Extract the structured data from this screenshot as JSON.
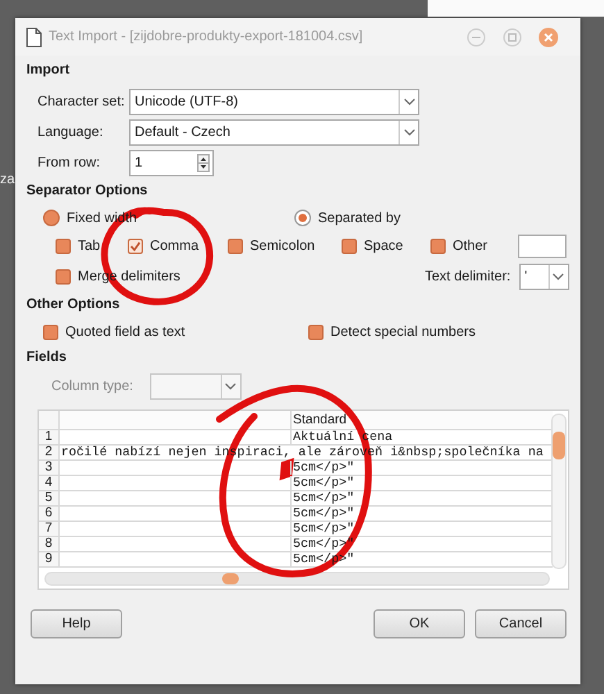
{
  "background": {
    "edge_text": "za"
  },
  "window": {
    "title": "Text Import - [zijdobre-produkty-export-181004.csv]"
  },
  "import": {
    "heading": "Import",
    "fields": [
      {
        "label": "Character set:",
        "value": "Unicode (UTF-8)",
        "kind": "combo"
      },
      {
        "label": "Language:",
        "value": "Default - Czech",
        "kind": "combo"
      },
      {
        "label": "From row:",
        "value": "1",
        "kind": "spin"
      }
    ]
  },
  "separator_options": {
    "heading": "Separator Options",
    "modes": [
      {
        "label": "Fixed width",
        "selected": false
      },
      {
        "label": "Separated by",
        "selected": true
      }
    ],
    "separators": [
      {
        "label": "Tab",
        "checked": false
      },
      {
        "label": "Comma",
        "checked": true
      },
      {
        "label": "Semicolon",
        "checked": false
      },
      {
        "label": "Space",
        "checked": false
      },
      {
        "label": "Other",
        "checked": false
      }
    ],
    "merge_delimiters": {
      "label": "Merge delimiters",
      "checked": false
    },
    "text_delimiter": {
      "label": "Text delimiter:",
      "value": "'"
    }
  },
  "other_options": {
    "heading": "Other Options",
    "options": [
      {
        "label": "Quoted field as text",
        "checked": false
      },
      {
        "label": "Detect special numbers",
        "checked": false
      }
    ]
  },
  "fields": {
    "heading": "Fields",
    "column_type_label": "Column type:",
    "columns": [
      "",
      "Standard"
    ],
    "rows": [
      {
        "number": "1",
        "cells": [
          "",
          "Aktuální cena"
        ]
      },
      {
        "number": "2",
        "cells": [
          "ročilé nabízí nejen inspiraci, ale zároveň i&nbsp;společníka na"
        ]
      },
      {
        "number": "3",
        "cells": [
          "",
          "5cm</p>\""
        ]
      },
      {
        "number": "4",
        "cells": [
          "",
          "5cm</p>\""
        ]
      },
      {
        "number": "5",
        "cells": [
          "",
          "5cm</p>\""
        ]
      },
      {
        "number": "6",
        "cells": [
          "",
          "5cm</p>\""
        ]
      },
      {
        "number": "7",
        "cells": [
          "",
          "5cm</p>\""
        ]
      },
      {
        "number": "8",
        "cells": [
          "",
          "5cm</p>\""
        ]
      },
      {
        "number": "9",
        "cells": [
          "",
          "5cm</p>\""
        ]
      }
    ]
  },
  "buttons": [
    {
      "label": "Help",
      "kind": "help"
    },
    {
      "label": "OK",
      "kind": "action"
    },
    {
      "label": "Cancel",
      "kind": "action"
    }
  ]
}
